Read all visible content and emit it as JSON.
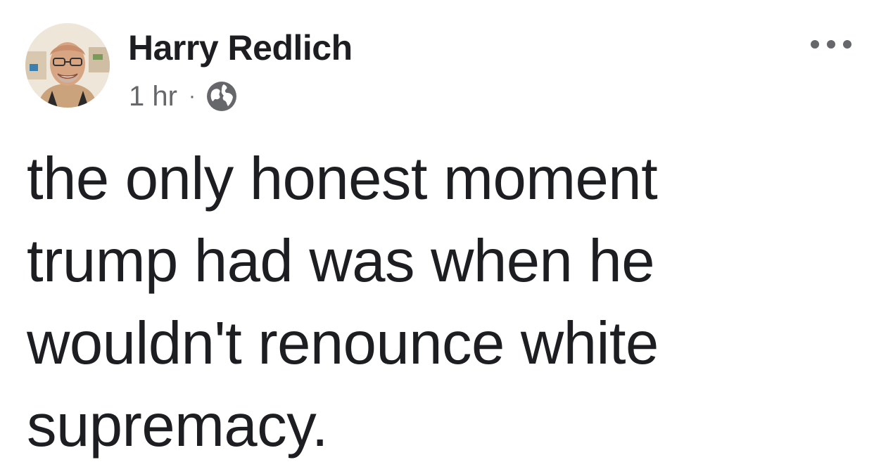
{
  "post": {
    "author": {
      "name": "Harry Redlich",
      "avatar_icon": "profile-photo"
    },
    "timestamp": "1 hr",
    "separator": "·",
    "audience_icon": "globe-icon",
    "menu_icon": "more-options-icon",
    "text_lines": [
      "the only honest moment",
      "trump had was when he",
      "wouldn't renounce white",
      "supremacy."
    ]
  },
  "colors": {
    "text_primary": "#1c1e21",
    "text_secondary": "#65676b",
    "background": "#ffffff"
  }
}
